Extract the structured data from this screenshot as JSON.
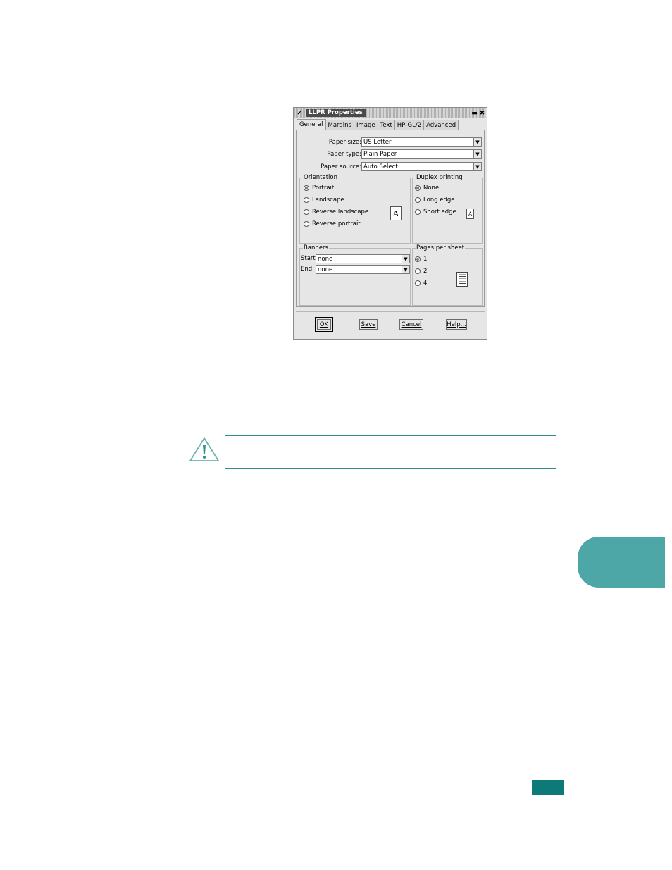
{
  "window": {
    "title": "LLPR Properties",
    "menu_glyph": "✔",
    "minimize_glyph": "▬",
    "close_glyph": "✖"
  },
  "tabs": [
    "General",
    "Margins",
    "Image",
    "Text",
    "HP-GL/2",
    "Advanced"
  ],
  "active_tab": "General",
  "paper_size": {
    "label": "Paper size:",
    "value": "US Letter"
  },
  "paper_type": {
    "label": "Paper type:",
    "value": "Plain Paper"
  },
  "paper_source": {
    "label": "Paper source:",
    "value": "Auto Select"
  },
  "orientation": {
    "legend": "Orientation",
    "options": [
      "Portrait",
      "Landscape",
      "Reverse landscape",
      "Reverse portrait"
    ],
    "selected": "Portrait",
    "preview_letter": "A"
  },
  "duplex": {
    "legend": "Duplex printing",
    "options": [
      "None",
      "Long edge",
      "Short edge"
    ],
    "selected": "None",
    "preview_letter": "A"
  },
  "banners": {
    "legend": "Banners",
    "start_label": "Start:",
    "start_value": "none",
    "end_label": "End:",
    "end_value": "none"
  },
  "pages_per_sheet": {
    "legend": "Pages per sheet",
    "options": [
      "1",
      "2",
      "4"
    ],
    "selected": "1"
  },
  "buttons": {
    "ok": "OK",
    "save": "Save",
    "cancel": "Cancel",
    "help": "Help..."
  },
  "colors": {
    "accent": "#4da7a6",
    "dark_accent": "#0d7a77",
    "rule": "#2f8f8a"
  }
}
